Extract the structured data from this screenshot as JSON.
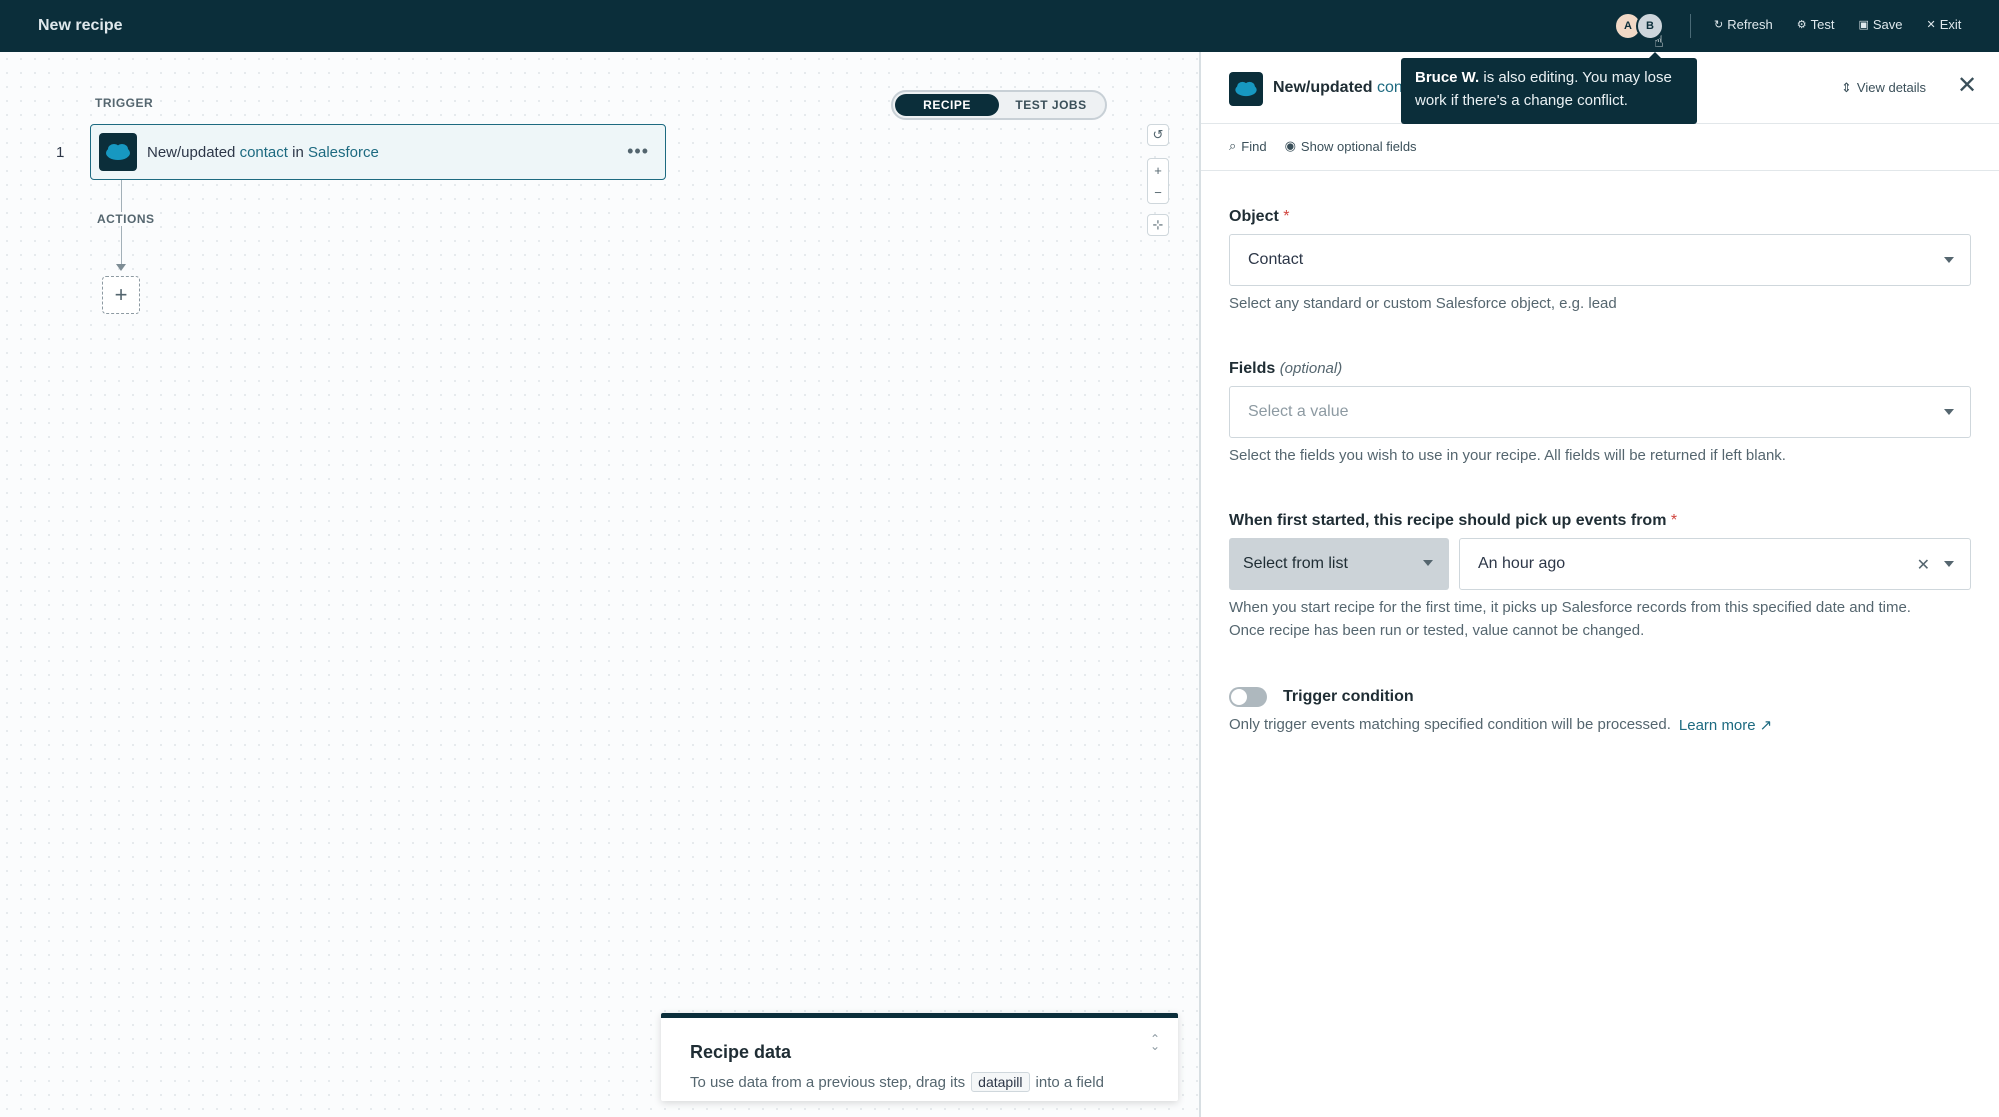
{
  "app": {
    "title": "New recipe"
  },
  "header": {
    "avatars": [
      {
        "initial": "A"
      },
      {
        "initial": "B"
      }
    ],
    "actions": {
      "refresh": "Refresh",
      "test": "Test",
      "save": "Save",
      "exit": "Exit"
    }
  },
  "tabs": {
    "recipe": "RECIPE",
    "test_jobs": "TEST JOBS"
  },
  "canvas": {
    "trigger_label": "TRIGGER",
    "actions_label": "ACTIONS",
    "step_number": "1",
    "trigger": {
      "prefix": "New/updated",
      "object": "contact",
      "middle": "in",
      "app": "Salesforce"
    }
  },
  "recipe_data": {
    "title": "Recipe data",
    "hint_before": "To use data from a previous step, drag its",
    "pill": "datapill",
    "hint_after": "into a field"
  },
  "panel": {
    "title_prefix": "New/updated",
    "title_rest": "cont",
    "view_details": "View details",
    "tools": {
      "find": "Find",
      "optional": "Show optional fields"
    },
    "object": {
      "label": "Object",
      "required": "*",
      "value": "Contact",
      "help": "Select any standard or custom Salesforce object, e.g. lead"
    },
    "fields": {
      "label": "Fields",
      "optional": "(optional)",
      "placeholder": "Select a value",
      "help": "Select the fields you wish to use in your recipe. All fields will be returned if left blank."
    },
    "since": {
      "label": "When first started, this recipe should pick up events from",
      "required": "*",
      "mode": "Select from list",
      "value": "An hour ago",
      "help_line1": "When you start recipe for the first time, it picks up Salesforce records from this specified date and time.",
      "help_line2": "Once recipe has been run or tested, value cannot be changed."
    },
    "condition": {
      "label": "Trigger condition",
      "help": "Only trigger events matching specified condition will be processed.",
      "learn_more": "Learn more"
    }
  },
  "tooltip": {
    "name": "Bruce W.",
    "text": "is also editing. You may lose work if there's a change conflict."
  },
  "colors": {
    "brand_dark": "#0b2e3a",
    "accent": "#1d6a80",
    "required": "#d0443e"
  }
}
